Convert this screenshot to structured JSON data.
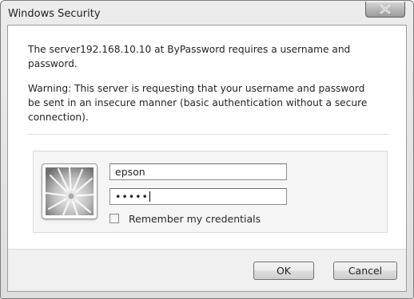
{
  "window": {
    "title": "Windows Security",
    "close_icon": "close-icon"
  },
  "message": {
    "line1": "The server192.168.10.10 at ByPassword requires a username and password.",
    "warning": "Warning: This server is requesting that your username and password be sent in an insecure manner (basic authentication without a secure connection)."
  },
  "credentials": {
    "tile_icon": "user-picture-flower-icon",
    "username_value": "epson",
    "password_value": "•••••",
    "remember_label": "Remember my credentials",
    "remember_checked": false
  },
  "buttons": {
    "ok_label": "OK",
    "cancel_label": "Cancel"
  }
}
